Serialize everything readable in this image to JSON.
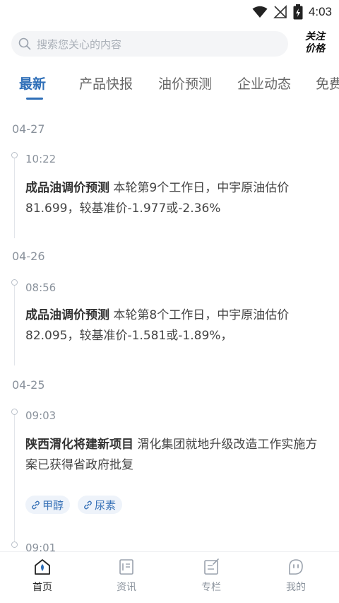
{
  "status_bar": {
    "time": "4:03",
    "icons": [
      "wifi-icon",
      "signal-icon",
      "battery-icon"
    ]
  },
  "search": {
    "placeholder": "搜索您关心的内容",
    "follow_price_line1": "关注",
    "follow_price_line2": "价格"
  },
  "tabs": [
    {
      "label": "最新",
      "active": true
    },
    {
      "label": "产品快报",
      "active": false
    },
    {
      "label": "油价预测",
      "active": false
    },
    {
      "label": "企业动态",
      "active": false
    },
    {
      "label": "免费",
      "active": false
    }
  ],
  "feed": {
    "groups": [
      {
        "date": "04-27",
        "items": [
          {
            "time": "10:22",
            "title": "成品油调价预测",
            "body": " 本轮第9个工作日，中宇原油估价81.699，较基准价-1.977或-2.36%"
          }
        ]
      },
      {
        "date": "04-26",
        "items": [
          {
            "time": "08:56",
            "title": "成品油调价预测",
            "body": " 本轮第8个工作日，中宇原油估价82.095，较基准价-1.581或-1.89%，"
          }
        ]
      },
      {
        "date": "04-25",
        "items": [
          {
            "time": "09:03",
            "title": "陕西渭化将建新项目",
            "body": " 渭化集团就地升级改造工作实施方案已获得省政府批复",
            "tags": [
              "甲醇",
              "尿素"
            ]
          },
          {
            "time": "09:01"
          }
        ]
      }
    ]
  },
  "bottom_nav": [
    {
      "label": "首页",
      "icon": "home-icon",
      "active": true
    },
    {
      "label": "资讯",
      "icon": "news-icon",
      "active": false
    },
    {
      "label": "专栏",
      "icon": "column-icon",
      "active": false
    },
    {
      "label": "我的",
      "icon": "profile-icon",
      "active": false
    }
  ],
  "colors": {
    "accent": "#2f6fb8",
    "tag_bg": "#eef3fa",
    "muted": "#8a929c"
  }
}
